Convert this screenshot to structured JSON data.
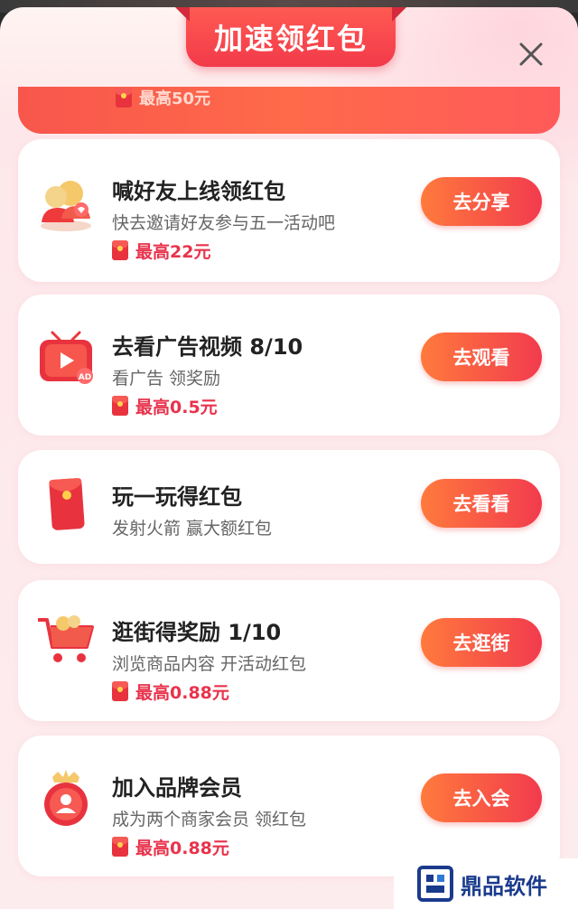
{
  "header": {
    "title": "加速领红包",
    "close_icon": "close-icon"
  },
  "previous_task": {
    "reward": "最高50元"
  },
  "tasks": [
    {
      "icon": "friends-icon",
      "title": "喊好友上线领红包",
      "desc": "快去邀请好友参与五一活动吧",
      "reward": "最高22元",
      "button": "去分享"
    },
    {
      "icon": "video-ad-icon",
      "title": "去看广告视频 8/10",
      "desc": "看广告 领奖励",
      "reward": "最高0.5元",
      "button": "去观看"
    },
    {
      "icon": "red-envelope-icon",
      "title": "玩一玩得红包",
      "desc": "发射火箭 赢大额红包",
      "reward": "",
      "button": "去看看"
    },
    {
      "icon": "shopping-cart-icon",
      "title": "逛街得奖励 1/10",
      "desc": "浏览商品内容 开活动红包",
      "reward": "最高0.88元",
      "button": "去逛街"
    },
    {
      "icon": "member-badge-icon",
      "title": "加入品牌会员",
      "desc": "成为两个商家会员 领红包",
      "reward": "最高0.88元",
      "button": "去入会"
    }
  ],
  "watermark": {
    "text": "鼎品软件"
  },
  "colors": {
    "accent": "#f23b4e",
    "button_start": "#ff7a3c",
    "reward_text": "#e8334c"
  }
}
